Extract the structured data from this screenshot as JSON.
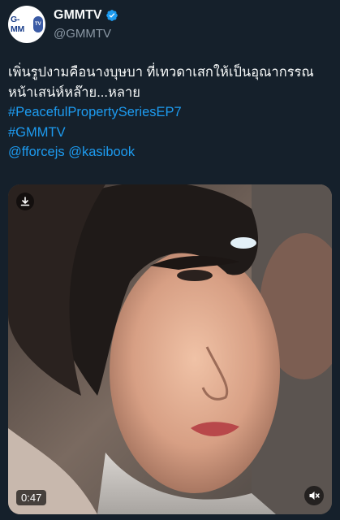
{
  "account": {
    "logo_text": "G-MM",
    "logo_tv": "TV",
    "display_name": "GMMTV",
    "handle": "@GMMTV",
    "verified_icon": "verified-badge-icon",
    "accent_color": "#1d9bf0"
  },
  "tweet": {
    "line1": "เพิ่นรูปงามคือนางบุษบา ที่เทวดาเสกให้เป็นอุณากรรณ",
    "line2": "หน้าเสน่ห์หล๊าย...หลาย",
    "hashtag1": "#PeacefulPropertySeriesEP7",
    "hashtag2": "#GMMTV",
    "mention1": "@fforcejs",
    "mention2": "@kasibook"
  },
  "media": {
    "duration": "0:47",
    "download_icon": "download-icon",
    "mute_icon": "muted-speaker-icon"
  }
}
